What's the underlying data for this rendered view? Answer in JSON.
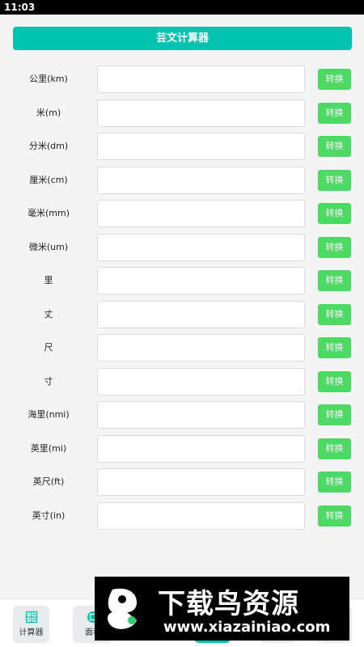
{
  "status_bar": {
    "time": "11:03"
  },
  "header": {
    "title": "芸文计算器"
  },
  "convert_label": "转换",
  "rows": [
    {
      "label": "公里(km)",
      "value": ""
    },
    {
      "label": "米(m)",
      "value": ""
    },
    {
      "label": "分米(dm)",
      "value": ""
    },
    {
      "label": "厘米(cm)",
      "value": ""
    },
    {
      "label": "毫米(mm)",
      "value": ""
    },
    {
      "label": "微米(um)",
      "value": ""
    },
    {
      "label": "里",
      "value": ""
    },
    {
      "label": "丈",
      "value": ""
    },
    {
      "label": "尺",
      "value": ""
    },
    {
      "label": "寸",
      "value": ""
    },
    {
      "label": "海里(nmi)",
      "value": ""
    },
    {
      "label": "英里(mi)",
      "value": ""
    },
    {
      "label": "英尺(ft)",
      "value": ""
    },
    {
      "label": "英寸(in)",
      "value": ""
    }
  ],
  "bottom_nav": {
    "calc_label": "计算器",
    "area_label": "面积"
  },
  "watermark": {
    "title": "下载鸟资源",
    "url": "www.xiazainiao.com"
  },
  "colors": {
    "accent": "#00c3b0",
    "convert_button": "#4cd964"
  }
}
